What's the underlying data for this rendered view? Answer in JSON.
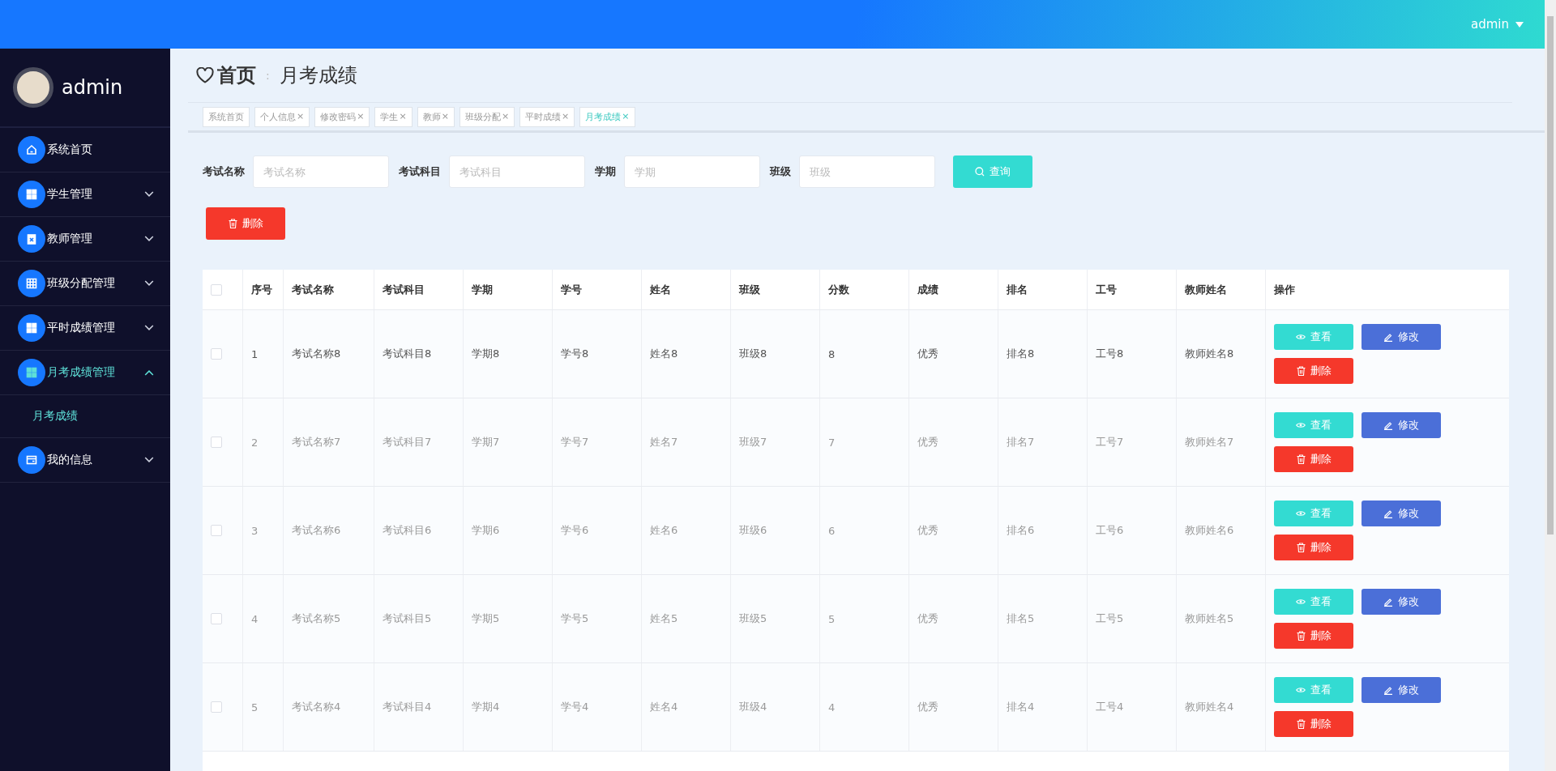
{
  "header": {
    "user": "admin"
  },
  "sidebar": {
    "user": "admin",
    "items": [
      {
        "label": "系统首页",
        "selected": false
      },
      {
        "label": "学生管理",
        "expanded": false,
        "selected": false
      },
      {
        "label": "教师管理",
        "expanded": false,
        "selected": false
      },
      {
        "label": "班级分配管理",
        "expanded": false,
        "selected": false
      },
      {
        "label": "平时成绩管理",
        "expanded": false,
        "selected": false
      },
      {
        "label": "月考成绩管理",
        "expanded": true,
        "selected": true,
        "children": [
          {
            "label": "月考成绩",
            "selected": true
          }
        ]
      },
      {
        "label": "我的信息",
        "expanded": false,
        "selected": false
      }
    ]
  },
  "breadcrumb": {
    "home": "首页",
    "separator": ":",
    "current": "月考成绩"
  },
  "tabs": [
    {
      "label": "系统首页",
      "closable": false,
      "selected": false
    },
    {
      "label": "个人信息",
      "closable": true,
      "selected": false
    },
    {
      "label": "修改密码",
      "closable": true,
      "selected": false
    },
    {
      "label": "学生",
      "closable": true,
      "selected": false
    },
    {
      "label": "教师",
      "closable": true,
      "selected": false
    },
    {
      "label": "班级分配",
      "closable": true,
      "selected": false
    },
    {
      "label": "平时成绩",
      "closable": true,
      "selected": false
    },
    {
      "label": "月考成绩",
      "closable": true,
      "selected": true
    }
  ],
  "tab_close": "×",
  "search": {
    "fields": [
      {
        "label": "考试名称",
        "placeholder": "考试名称"
      },
      {
        "label": "考试科目",
        "placeholder": "考试科目"
      },
      {
        "label": "学期",
        "placeholder": "学期"
      },
      {
        "label": "班级",
        "placeholder": "班级"
      }
    ],
    "button": "查询"
  },
  "delete_button": "删除",
  "table": {
    "all_checked": false,
    "columns": [
      "序号",
      "考试名称",
      "考试科目",
      "学期",
      "学号",
      "姓名",
      "班级",
      "分数",
      "成绩",
      "排名",
      "工号",
      "教师姓名",
      "操作"
    ],
    "rows": [
      {
        "checked": false,
        "hovered": true,
        "cells": [
          "1",
          "考试名称8",
          "考试科目8",
          "学期8",
          "学号8",
          "姓名8",
          "班级8",
          "8",
          "优秀",
          "排名8",
          "工号8",
          "教师姓名8"
        ],
        "actions": [
          {
            "kind": "view",
            "label": "查看"
          },
          {
            "kind": "edit",
            "label": "修改"
          },
          {
            "kind": "delete",
            "label": "删除"
          }
        ]
      },
      {
        "checked": false,
        "hovered": false,
        "cells": [
          "2",
          "考试名称7",
          "考试科目7",
          "学期7",
          "学号7",
          "姓名7",
          "班级7",
          "7",
          "优秀",
          "排名7",
          "工号7",
          "教师姓名7"
        ],
        "actions": [
          {
            "kind": "view",
            "label": "查看"
          },
          {
            "kind": "edit",
            "label": "修改"
          },
          {
            "kind": "delete",
            "label": "删除"
          }
        ]
      },
      {
        "checked": false,
        "hovered": false,
        "cells": [
          "3",
          "考试名称6",
          "考试科目6",
          "学期6",
          "学号6",
          "姓名6",
          "班级6",
          "6",
          "优秀",
          "排名6",
          "工号6",
          "教师姓名6"
        ],
        "actions": [
          {
            "kind": "view",
            "label": "查看"
          },
          {
            "kind": "edit",
            "label": "修改"
          },
          {
            "kind": "delete",
            "label": "删除"
          }
        ]
      },
      {
        "checked": false,
        "hovered": false,
        "cells": [
          "4",
          "考试名称5",
          "考试科目5",
          "学期5",
          "学号5",
          "姓名5",
          "班级5",
          "5",
          "优秀",
          "排名5",
          "工号5",
          "教师姓名5"
        ],
        "actions": [
          {
            "kind": "view",
            "label": "查看"
          },
          {
            "kind": "edit",
            "label": "修改"
          },
          {
            "kind": "delete",
            "label": "删除"
          }
        ]
      },
      {
        "checked": false,
        "hovered": false,
        "cells": [
          "5",
          "考试名称4",
          "考试科目4",
          "学期4",
          "学号4",
          "姓名4",
          "班级4",
          "4",
          "优秀",
          "排名4",
          "工号4",
          "教师姓名4"
        ],
        "actions": [
          {
            "kind": "view",
            "label": "查看"
          },
          {
            "kind": "edit",
            "label": "修改"
          },
          {
            "kind": "delete",
            "label": "删除"
          }
        ]
      }
    ]
  }
}
